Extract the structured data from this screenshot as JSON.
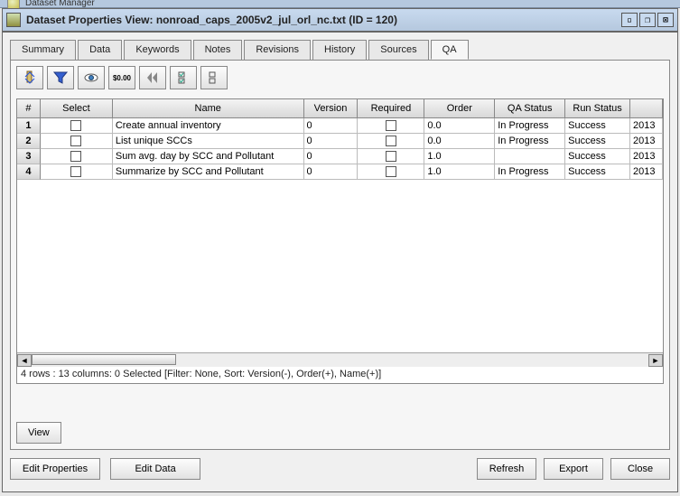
{
  "peek_title": "Dataset Manager",
  "window": {
    "title": "Dataset Properties View: nonroad_caps_2005v2_jul_orl_nc.txt (ID = 120)"
  },
  "tabs": {
    "items": [
      {
        "label": "Summary"
      },
      {
        "label": "Data"
      },
      {
        "label": "Keywords"
      },
      {
        "label": "Notes"
      },
      {
        "label": "Revisions"
      },
      {
        "label": "History"
      },
      {
        "label": "Sources"
      },
      {
        "label": "QA"
      }
    ],
    "active": 7
  },
  "toolbar": {
    "icons": [
      "sort-icon",
      "filter-icon",
      "view-icon",
      "format-icon",
      "first-icon",
      "select-icon",
      "clear-icon"
    ]
  },
  "grid": {
    "columns": [
      "#",
      "Select",
      "Name",
      "Version",
      "Required",
      "Order",
      "QA Status",
      "Run Status",
      ""
    ],
    "rows": [
      {
        "n": "1",
        "name": "Create annual inventory",
        "version": "0",
        "order": "0.0",
        "qa": "In Progress",
        "run": "Success",
        "extra": "2013"
      },
      {
        "n": "2",
        "name": "List unique SCCs",
        "version": "0",
        "order": "0.0",
        "qa": "In Progress",
        "run": "Success",
        "extra": "2013"
      },
      {
        "n": "3",
        "name": "Sum avg. day by SCC and Pollutant",
        "version": "0",
        "order": "1.0",
        "qa": "",
        "run": "Success",
        "extra": "2013"
      },
      {
        "n": "4",
        "name": "Summarize by SCC and Pollutant",
        "version": "0",
        "order": "1.0",
        "qa": "In Progress",
        "run": "Success",
        "extra": "2013"
      }
    ]
  },
  "status": "4 rows : 13 columns: 0 Selected [Filter: None, Sort: Version(-), Order(+), Name(+)]",
  "buttons": {
    "view": "View",
    "edit_properties": "Edit Properties",
    "edit_data": "Edit Data",
    "refresh": "Refresh",
    "export": "Export",
    "close": "Close"
  }
}
